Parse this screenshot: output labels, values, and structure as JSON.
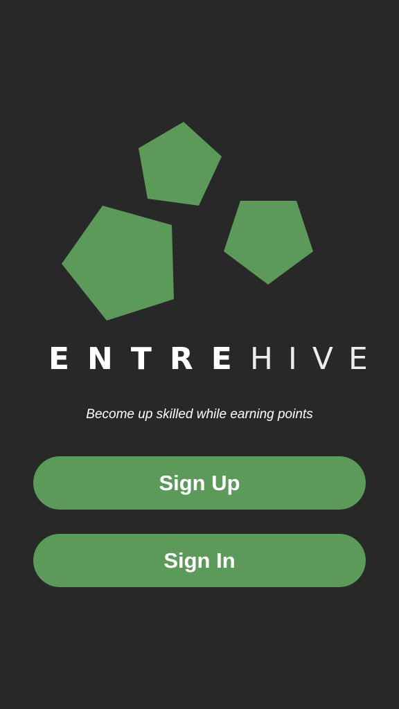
{
  "brand": {
    "name_bold": "ENTRE",
    "name_light": "HIVE",
    "accent_color": "#5c9a59",
    "logo_icon": "three-pentagons-logo-icon"
  },
  "tagline": "Become up skilled while earning points",
  "actions": {
    "sign_up_label": "Sign Up",
    "sign_in_label": "Sign In"
  }
}
